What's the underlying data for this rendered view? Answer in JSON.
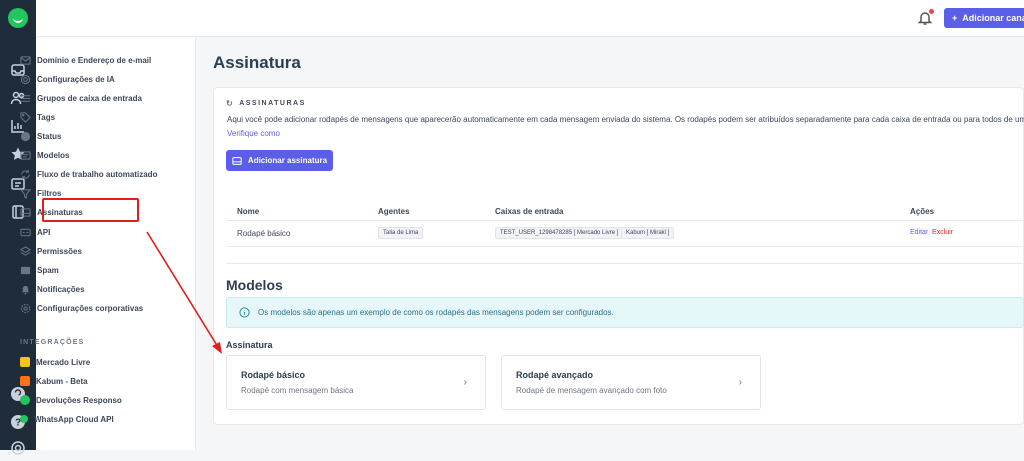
{
  "topbar": {
    "add_channel_label": "Adicionar canal"
  },
  "sidebar": {
    "items": [
      {
        "label": "Domínio e Endereço de e-mail",
        "icon": "mail-icon"
      },
      {
        "label": "Configurações de IA",
        "icon": "ai-icon"
      },
      {
        "label": "Grupos de caixa de entrada",
        "icon": "list-icon"
      },
      {
        "label": "Tags",
        "icon": "tag-icon"
      },
      {
        "label": "Status",
        "icon": "status-icon"
      },
      {
        "label": "Modelos",
        "icon": "template-icon"
      },
      {
        "label": "Fluxo de trabalho automatizado",
        "icon": "workflow-icon"
      },
      {
        "label": "Filtros",
        "icon": "filter-icon"
      },
      {
        "label": "Assinaturas",
        "icon": "signature-icon"
      },
      {
        "label": "API",
        "icon": "api-icon"
      },
      {
        "label": "Permissões",
        "icon": "permissions-icon"
      },
      {
        "label": "Spam",
        "icon": "spam-icon"
      },
      {
        "label": "Notificações",
        "icon": "bell-icon"
      },
      {
        "label": "Configurações corporativas",
        "icon": "gear-icon"
      }
    ],
    "integrations_title": "INTEGRAÇÕES",
    "integrations": [
      {
        "label": "Mercado Livre",
        "color": "#f5c518"
      },
      {
        "label": "Kabum - Beta",
        "color": "#f97316"
      },
      {
        "label": "Devoluções Responso",
        "color": "#22c55e"
      },
      {
        "label": "WhatsApp Cloud API",
        "color": "#22c55e"
      }
    ]
  },
  "main": {
    "page_title": "Assinatura",
    "section_label": "ASSINATURAS",
    "description": "Aqui você pode adicionar rodapés de mensagens que aparecerão automaticamente em cada mensagem enviada do sistema. Os rodapés podem ser atribuídos separadamente para cada caixa de entrada ou para todos de uma vez.",
    "link": "Verifique como",
    "add_button": "Adicionar assinatura",
    "table": {
      "headers": [
        "Nome",
        "Agentes",
        "Caixas de entrada",
        "Ações"
      ],
      "row": {
        "name": "Rodapé básico",
        "agent": "Talia de Lima",
        "inbox1": "TEST_USER_1298478285 [ Mercado Livre ]",
        "inbox2": "Kabum [ Mirakl ]",
        "edit": "Editar",
        "delete": "Excluir"
      }
    },
    "models_title": "Modelos",
    "info": "Os modelos são apenas um exemplo de como os rodapés das mensagens podem ser configurados.",
    "signature_label": "Assinatura",
    "templates": [
      {
        "title": "Rodapé básico",
        "subtitle": "Rodapé com mensagem básica"
      },
      {
        "title": "Rodapé avançado",
        "subtitle": "Rodapé de mensagem avançado com foto"
      }
    ]
  },
  "colors": {
    "accent": "#5b5fe8",
    "annotation": "#e11d1d",
    "rail": "#1f2d3a"
  }
}
